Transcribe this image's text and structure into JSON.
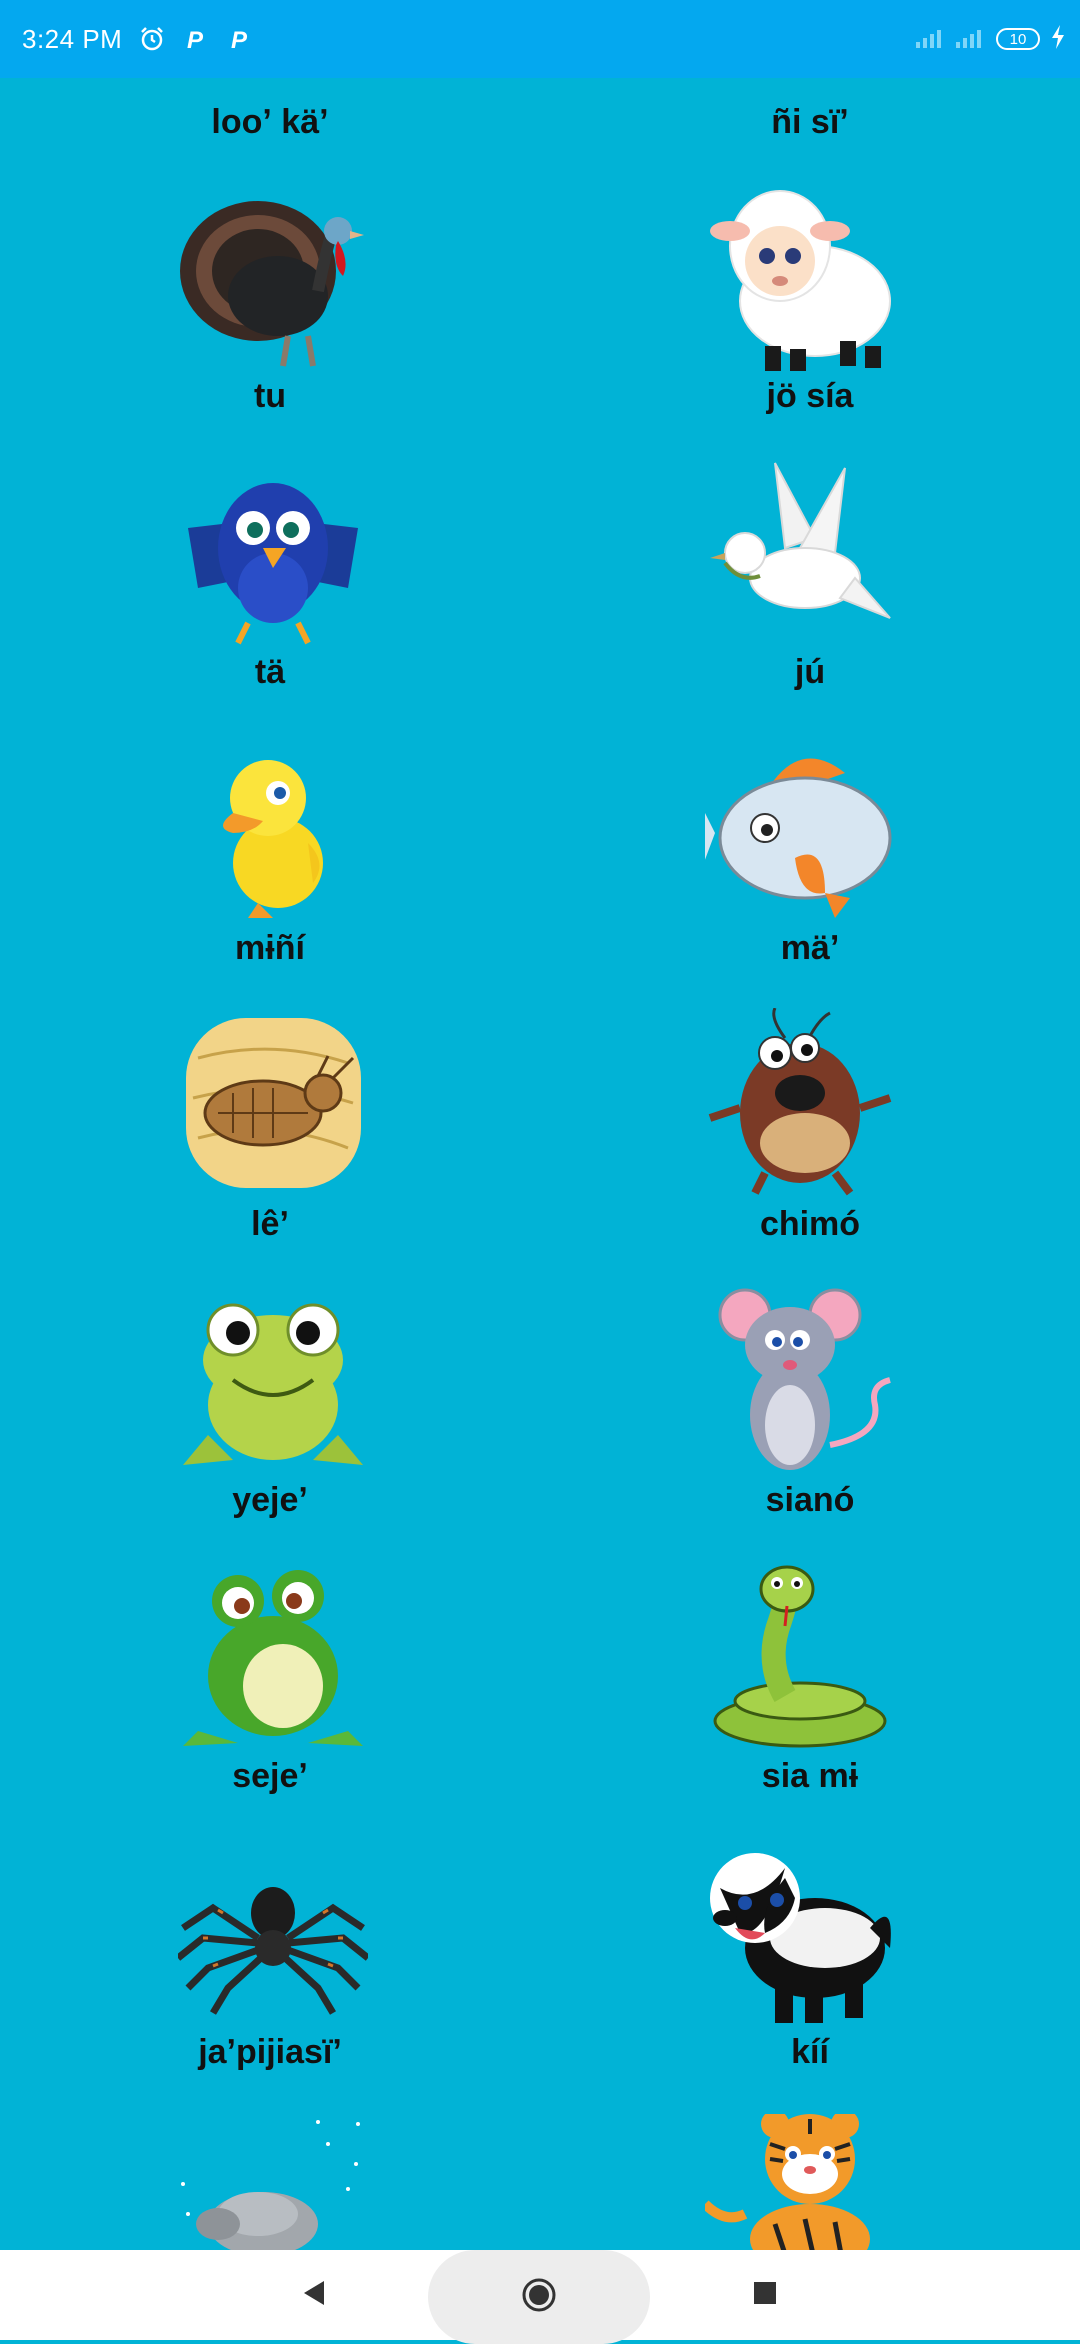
{
  "status_bar": {
    "time": "3:24 PM",
    "battery": "10",
    "icons": [
      "alarm-icon",
      "parking-p-icon",
      "parking-p-icon",
      "signal-icon",
      "signal-icon",
      "battery-icon",
      "charging-bolt-icon"
    ]
  },
  "colors": {
    "status_bar": "#04a8ef",
    "background": "#01b3d6",
    "label_text": "#111111",
    "nav_bar": "#ffffff"
  },
  "animals": [
    {
      "label": "looʼ käʼ",
      "icon": "none"
    },
    {
      "label": "ñi sïʼ",
      "icon": "none"
    },
    {
      "label": "tu",
      "icon": "turkey-icon"
    },
    {
      "label": "jö sía",
      "icon": "sheep-icon"
    },
    {
      "label": "tä",
      "icon": "blue-bird-icon"
    },
    {
      "label": "jú",
      "icon": "dove-icon"
    },
    {
      "label": "mɨñí",
      "icon": "duckling-icon"
    },
    {
      "label": "mäʼ",
      "icon": "fish-icon"
    },
    {
      "label": "lêʼ",
      "icon": "flea-icon"
    },
    {
      "label": "chimó",
      "icon": "cockroach-icon"
    },
    {
      "label": "yejeʼ",
      "icon": "toad-icon"
    },
    {
      "label": "sianó",
      "icon": "mouse-icon"
    },
    {
      "label": "sejeʼ",
      "icon": "frog-icon"
    },
    {
      "label": "sia mɨ",
      "icon": "snake-icon"
    },
    {
      "label": "jaʼpijiasïʼ",
      "icon": "spider-icon"
    },
    {
      "label": "kíí",
      "icon": "badger-icon"
    },
    {
      "label": "",
      "icon": "armadillo-icon"
    },
    {
      "label": "",
      "icon": "tiger-icon"
    }
  ],
  "nav": {
    "back": "back-icon",
    "home": "home-icon",
    "recents": "recents-icon"
  }
}
